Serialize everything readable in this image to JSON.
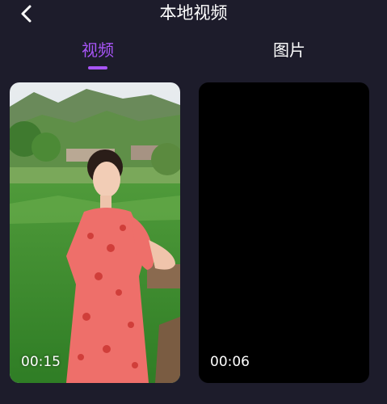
{
  "header": {
    "title": "本地视频",
    "back_icon": "chevron-left-icon"
  },
  "tabs": [
    {
      "label": "视频",
      "selected": true
    },
    {
      "label": "图片",
      "selected": false
    }
  ],
  "videos": [
    {
      "duration": "00:15"
    },
    {
      "duration": "00:06"
    }
  ],
  "colors": {
    "background": "#1d1c2b",
    "accent": "#a855f7",
    "text": "#ffffff"
  }
}
